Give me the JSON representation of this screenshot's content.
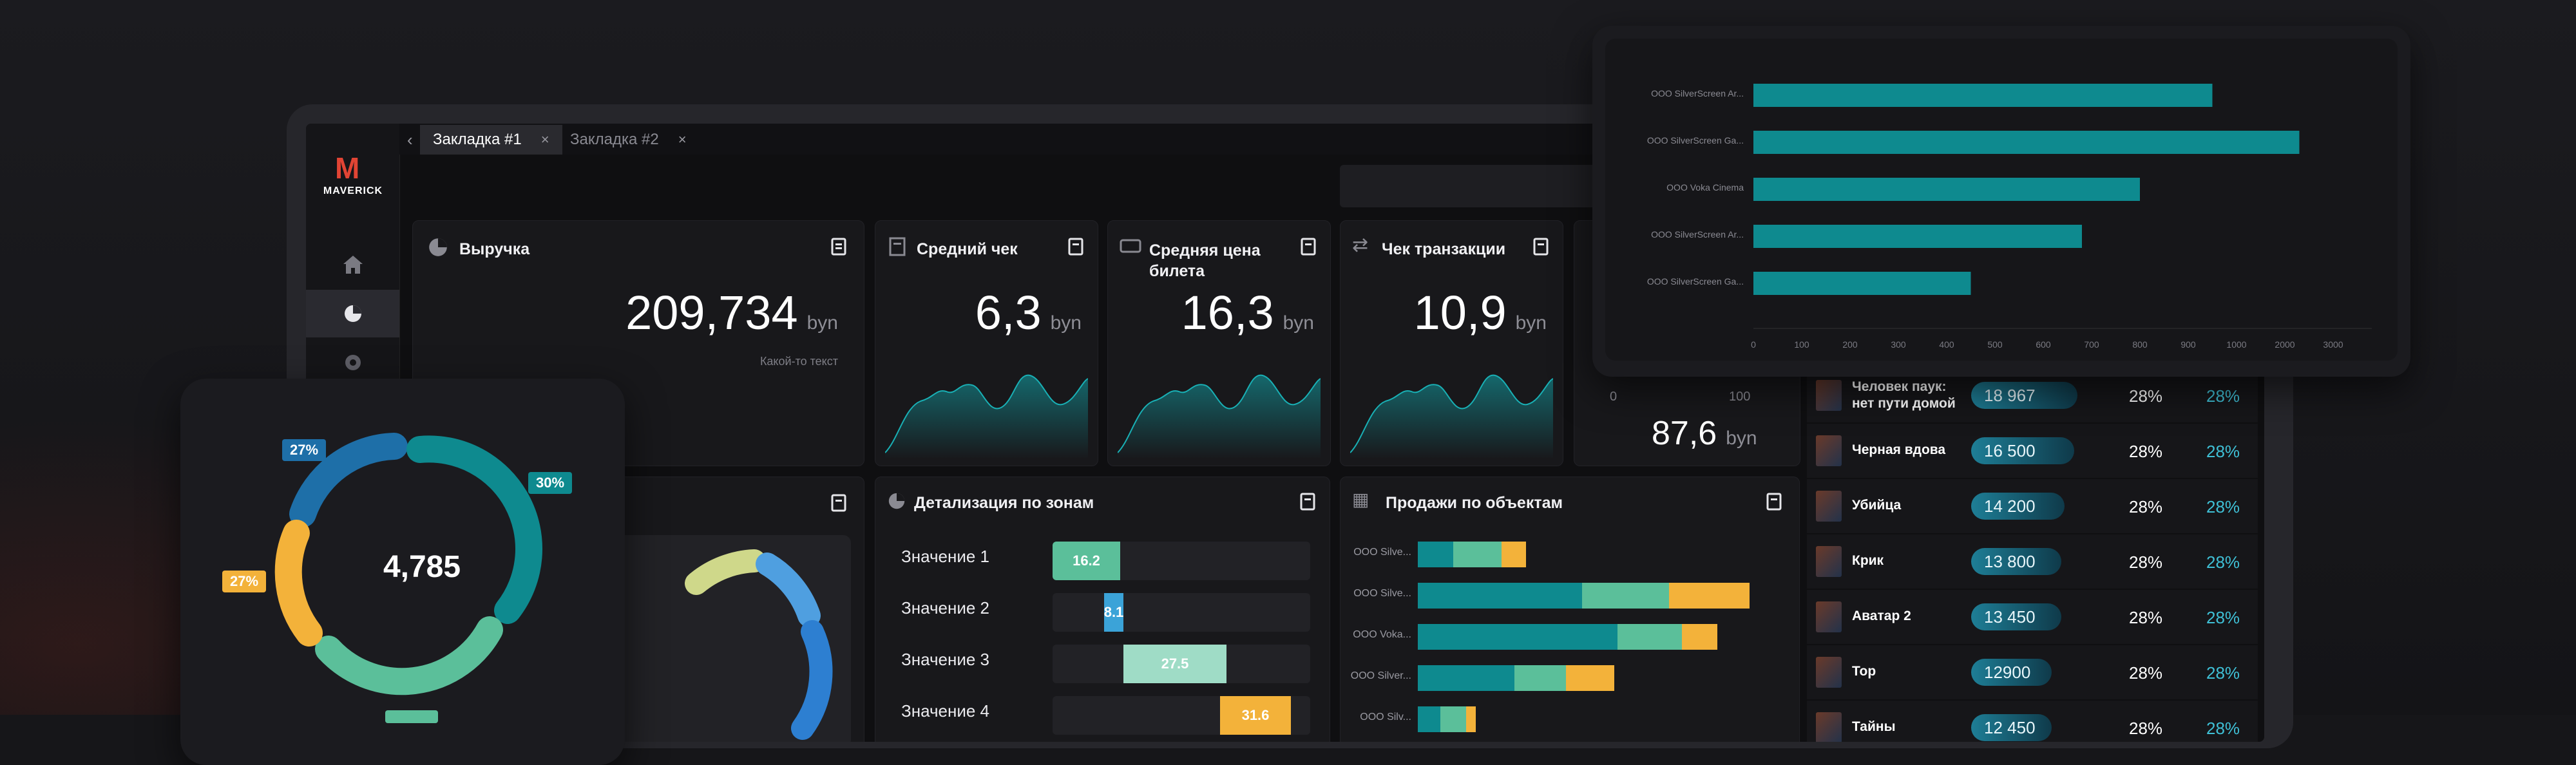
{
  "brand": {
    "logo_letter": "M",
    "logo_text": "MAVERICK"
  },
  "tabs": [
    {
      "label": "Закладка #1",
      "active": true
    },
    {
      "label": "Закладка #2",
      "active": false
    }
  ],
  "kpi": [
    {
      "title": "Выручка",
      "value": "209,734",
      "unit": "byn",
      "caption": "Какой-то текст"
    },
    {
      "title": "Средний чек",
      "value": "6,3",
      "unit": "byn"
    },
    {
      "title": "Средняя цена",
      "title2": "билета",
      "value": "16,3",
      "unit": "byn"
    },
    {
      "title": "Чек транзакции",
      "value": "10,9",
      "unit": "byn"
    }
  ],
  "gauge_card": {
    "min": "0",
    "max": "100",
    "value": "87,6",
    "unit": "byn"
  },
  "zones": {
    "title": "Детализация по зонам",
    "rows": [
      {
        "label": "Значение 1",
        "value": "16.2",
        "color": "#5bbf9a"
      },
      {
        "label": "Значение 2",
        "value": "8.1",
        "color": "#3ba3d8"
      },
      {
        "label": "Значение 3",
        "value": "27.5",
        "color": "#9fdcc6"
      },
      {
        "label": "Значение 4",
        "value": "31.6",
        "color": "#f3b23a"
      }
    ]
  },
  "sales": {
    "title": "Продажи по объектам",
    "labels": [
      "OOO Silve...",
      "OOO Silve...",
      "OOO Voka...",
      "OOO Silver...",
      "OOO Silv..."
    ]
  },
  "movies": [
    {
      "title": "Человек паук:",
      "title2": "нет пути домой",
      "value": "18 967",
      "p1": "28%",
      "p2": "28%"
    },
    {
      "title": "Черная вдова",
      "value": "16 500",
      "p1": "28%",
      "p2": "28%"
    },
    {
      "title": "Убийца",
      "value": "14 200",
      "p1": "28%",
      "p2": "28%"
    },
    {
      "title": "Крик",
      "value": "13 800",
      "p1": "28%",
      "p2": "28%"
    },
    {
      "title": "Аватар 2",
      "value": "13 450",
      "p1": "28%",
      "p2": "28%"
    },
    {
      "title": "Тор",
      "value": "12900",
      "p1": "28%",
      "p2": "28%"
    },
    {
      "title": "Тайны",
      "value": "12 450",
      "p1": "28%",
      "p2": "28%"
    }
  ],
  "donut_overlay": {
    "center": "4,785",
    "badges": [
      "27%",
      "30%",
      "27%"
    ]
  },
  "chart_data": {
    "type": "bar",
    "orientation": "horizontal",
    "categories": [
      "OOO SilverScreen Ar...",
      "OOO SilverScreen Ga...",
      "OOO Voka Cinema",
      "OOO SilverScreen Ar...",
      "OOO SilverScreen Ga..."
    ],
    "values": [
      950,
      2300,
      800,
      680,
      450
    ],
    "x_ticks": [
      "0",
      "100",
      "200",
      "300",
      "400",
      "500",
      "600",
      "700",
      "800",
      "900",
      "1000",
      "2000",
      "3000"
    ],
    "color": "#0e8a8f"
  },
  "colors": {
    "accent": "#0e8a8f",
    "teal_light": "#5bbf9a",
    "orange": "#f3b23a",
    "blue": "#1e6fa8"
  }
}
